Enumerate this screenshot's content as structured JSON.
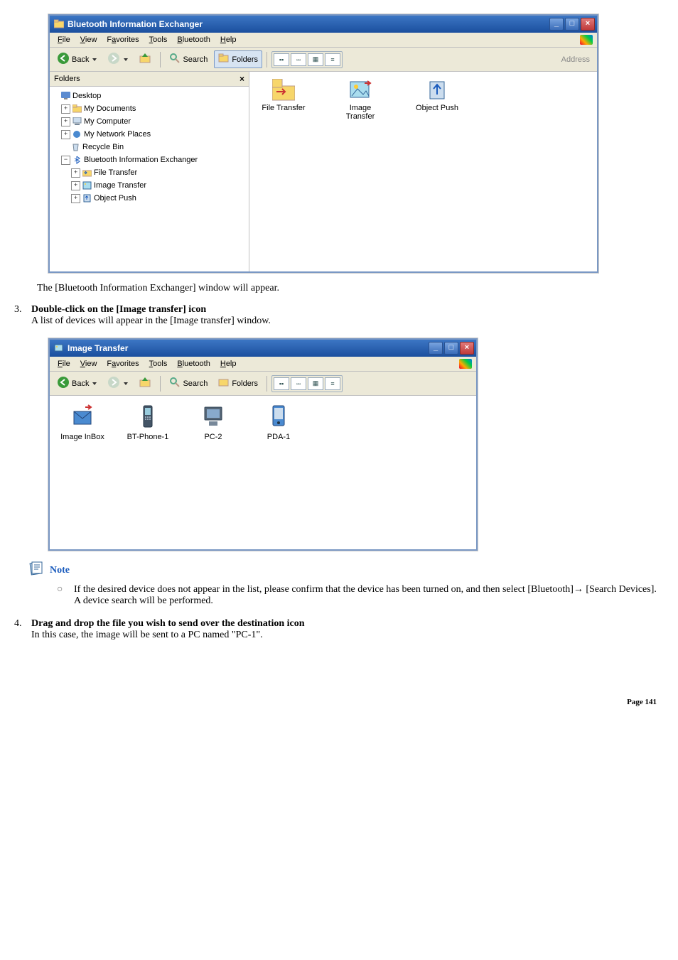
{
  "window1": {
    "title": "Bluetooth Information Exchanger",
    "menubar": [
      "File",
      "View",
      "Favorites",
      "Tools",
      "Bluetooth",
      "Help"
    ],
    "toolbar": {
      "back": "Back",
      "search": "Search",
      "folders": "Folders",
      "address": "Address"
    },
    "folders_label": "Folders",
    "tree": {
      "desktop": "Desktop",
      "mydocs": "My Documents",
      "mycomp": "My Computer",
      "mynet": "My Network Places",
      "recycle": "Recycle Bin",
      "bie": "Bluetooth Information Exchanger",
      "ft": "File Transfer",
      "it": "Image Transfer",
      "op": "Object Push"
    },
    "items": {
      "file_transfer": "File Transfer",
      "image_transfer": "Image\nTransfer",
      "object_push": "Object Push"
    }
  },
  "caption1": "The [Bluetooth Information Exchanger] window will appear.",
  "step3": {
    "num": "3.",
    "title": "Double-click on the [Image transfer] icon",
    "desc": "A list of devices will appear in the [Image transfer] window."
  },
  "window2": {
    "title": "Image Transfer",
    "menubar": [
      "File",
      "View",
      "Favorites",
      "Tools",
      "Bluetooth",
      "Help"
    ],
    "toolbar": {
      "back": "Back",
      "search": "Search",
      "folders": "Folders"
    },
    "devices": [
      {
        "name": "Image InBox"
      },
      {
        "name": "BT-Phone-1"
      },
      {
        "name": "PC-2"
      },
      {
        "name": "PDA-1"
      }
    ]
  },
  "note": {
    "label": "Note",
    "text": "If the desired device does not appear in the list, please confirm that the device has been turned on, and then select [Bluetooth]→ [Search Devices].",
    "text2": "A device search will be performed."
  },
  "step4": {
    "num": "4.",
    "title": "Drag and drop the file you wish to send over the destination icon",
    "desc": "In this case, the image will be sent to a PC named \"PC-1\"."
  },
  "footer": "Page 141"
}
